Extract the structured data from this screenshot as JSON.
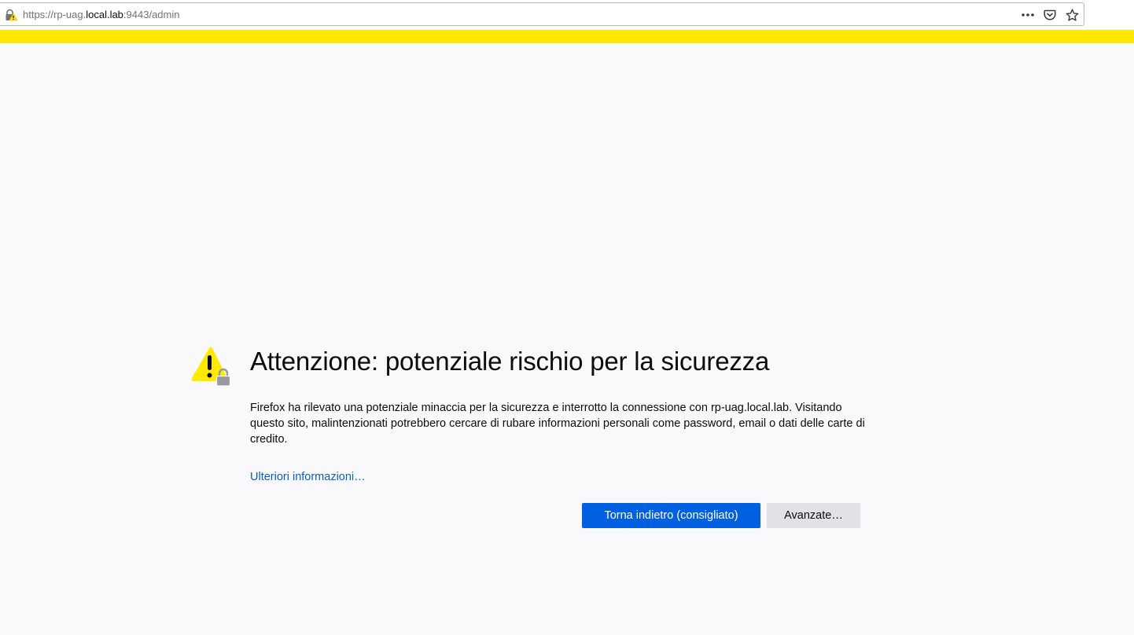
{
  "browser": {
    "url_prefix": "https://rp-uag.",
    "url_host": "local.lab",
    "url_suffix": ":9443/admin",
    "icons": {
      "security": "warning-lock-icon",
      "page_actions": "more-dots-icon",
      "pocket": "pocket-icon",
      "bookmark": "star-icon"
    }
  },
  "colors": {
    "warning_bar": "#ffe900",
    "primary_button": "#0060df",
    "link": "#0a5fc8",
    "page_background": "#f9f9fb"
  },
  "error_page": {
    "icon": "warning-triangle-lock-icon",
    "title": "Attenzione: potenziale rischio per la sicurezza",
    "description": "Firefox ha rilevato una potenziale minaccia per la sicurezza e interrotto la connessione con rp-uag.local.lab. Visitando questo sito, malintenzionati potrebbero cercare di rubare informazioni personali come password, email o dati delle carte di credito.",
    "learn_more": "Ulteriori informazioni…",
    "go_back_button": "Torna indietro (consigliato)",
    "advanced_button": "Avanzate…"
  }
}
